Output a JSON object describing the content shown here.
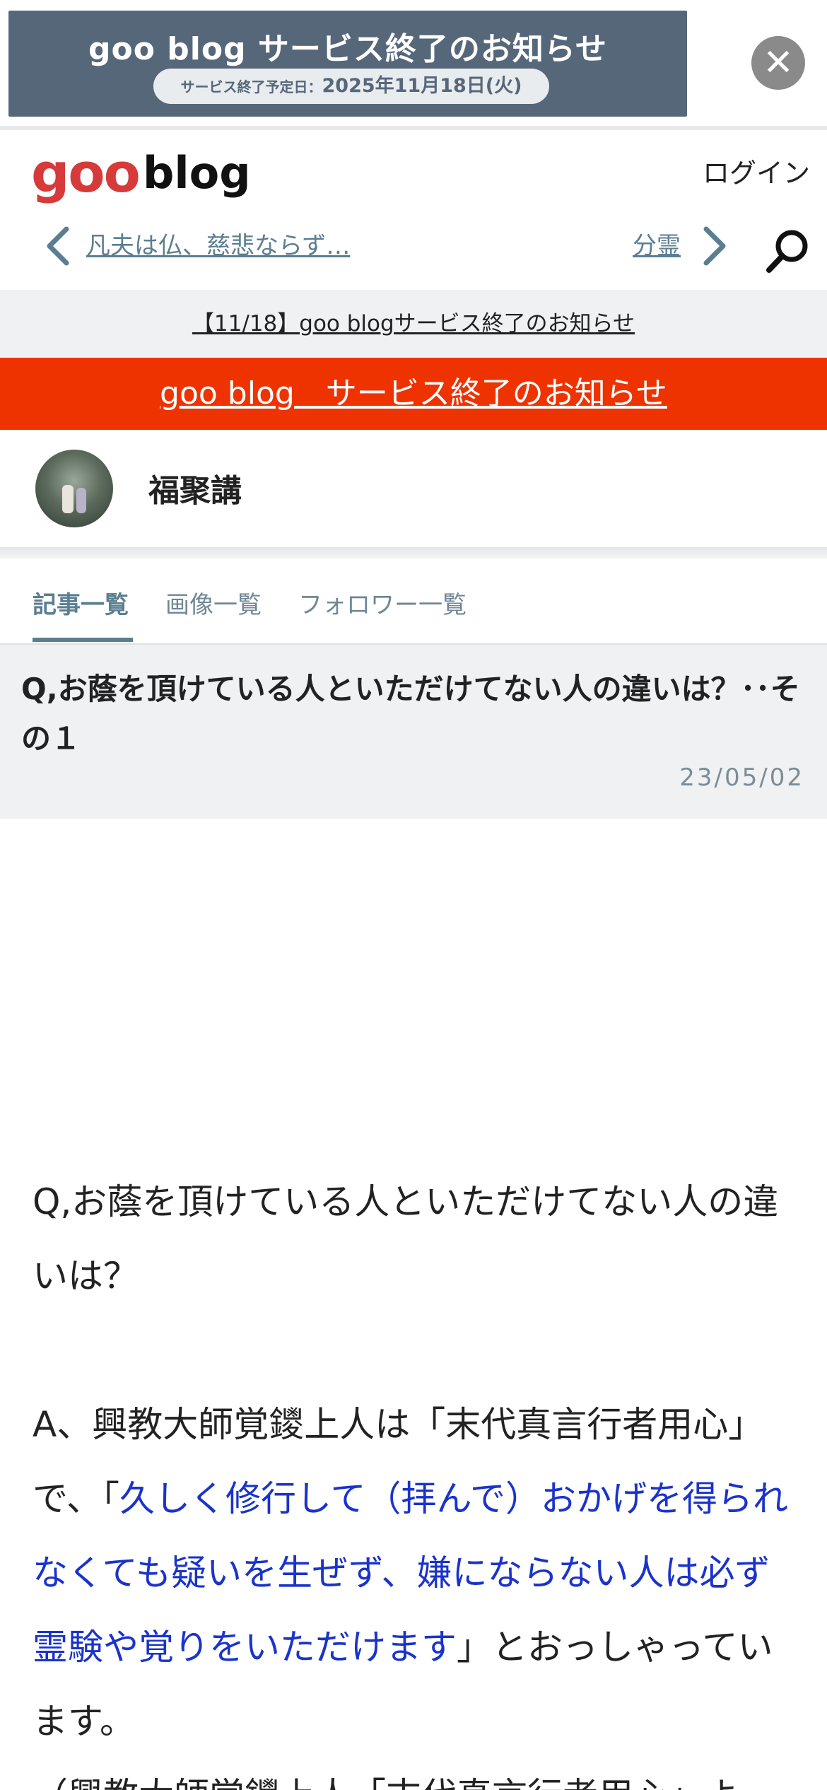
{
  "ad_banner": {
    "title": "goo blog サービス終了のお知らせ",
    "pill_label": "サービス終了予定日：",
    "pill_date": "2025年11月18日(火)",
    "close_symbol": "✕"
  },
  "header": {
    "logo_goo": "goo",
    "logo_blog": "blog",
    "login_label": "ログイン",
    "prev_link": "凡夫は仏、慈悲ならず…",
    "next_link": "分霊"
  },
  "notice": {
    "text": "【11/18】goo blogサービス終了のお知らせ"
  },
  "red_notice": {
    "text": "goo blog　サービス終了のお知らせ"
  },
  "profile": {
    "blog_name": "福聚講"
  },
  "tabs": [
    {
      "label": "記事一覧",
      "active": true
    },
    {
      "label": "画像一覧",
      "active": false
    },
    {
      "label": "フォロワー一覧",
      "active": false
    }
  ],
  "article": {
    "title": "Q,お蔭を頂けている人といただけてない人の違いは？･･その１",
    "date": "23/05/02",
    "body": {
      "q_line": "Q,お蔭を頂けている人といただけてない人の違いは？",
      "a_intro": "A、興教大師覚鑁上人は「末代真言行者用心」で、「",
      "a_quote": "久しく修行して（拝んで）おかげを得られなくても疑いを生ぜず、嫌にならない人は必ず霊験や覚りをいただけます",
      "a_outro": "」とおっしゃっています。",
      "partial_next": "（興教大師覚鑁上人「末代真言行者用心」よ"
    }
  },
  "colors": {
    "banner_bg": "#56677a",
    "red_bar": "#ee3300",
    "accent": "#5b7e91",
    "logo_red": "#d73a3a",
    "quote_blue": "#1a33cc"
  }
}
